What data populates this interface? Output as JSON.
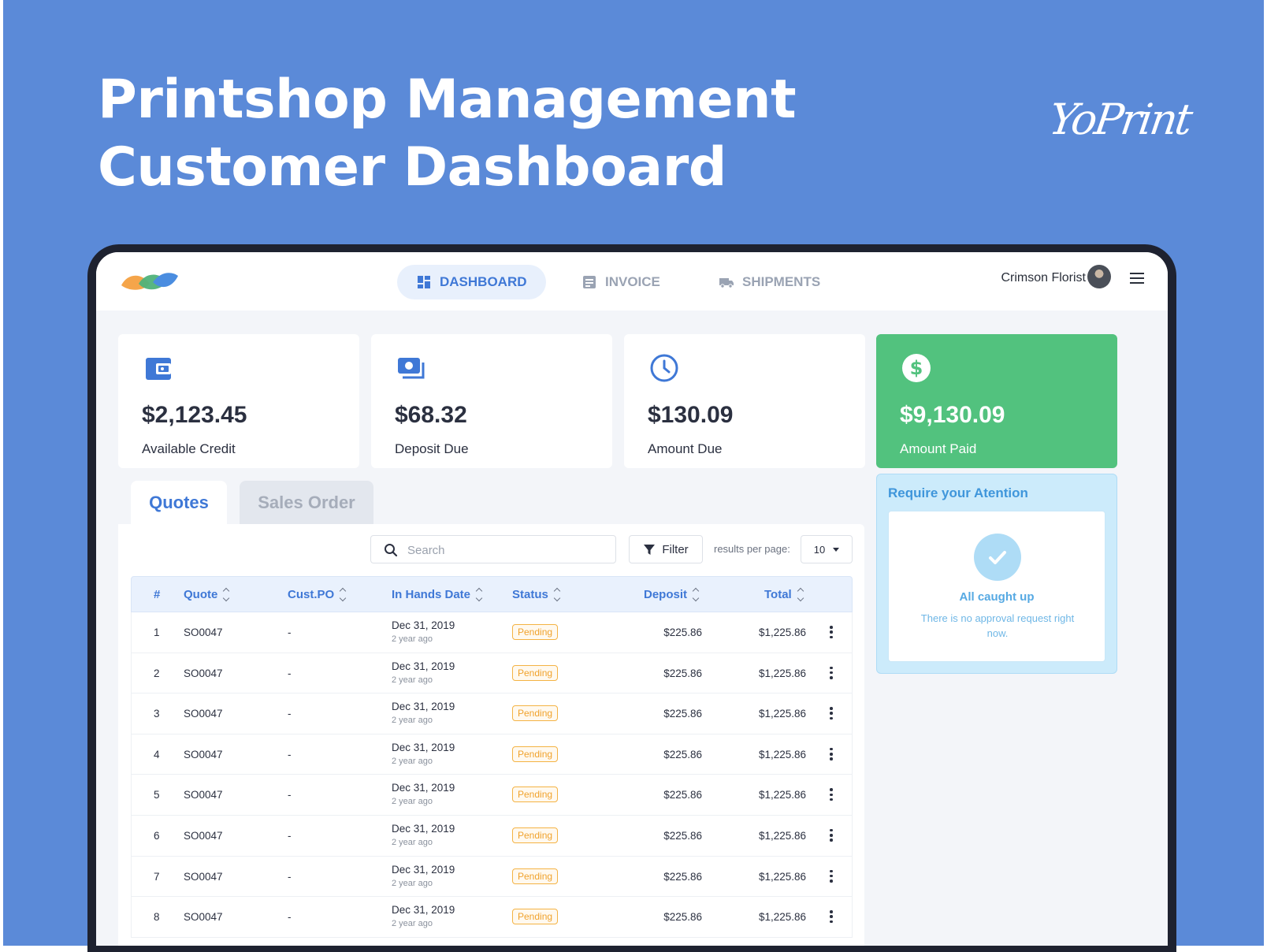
{
  "hero": {
    "title_line1": "Printshop Management",
    "title_line2": "Customer Dashboard",
    "brand": "YoPrint"
  },
  "nav": {
    "items": [
      {
        "label": "DASHBOARD",
        "icon": "dashboard-icon",
        "active": true
      },
      {
        "label": "INVOICE",
        "icon": "invoice-icon",
        "active": false
      },
      {
        "label": "SHIPMENTS",
        "icon": "truck-icon",
        "active": false
      }
    ],
    "user": "Crimson Florist"
  },
  "cards": [
    {
      "amount": "$2,123.45",
      "label": "Available Credit",
      "icon": "wallet-icon"
    },
    {
      "amount": "$68.32",
      "label": "Deposit Due",
      "icon": "cash-icon"
    },
    {
      "amount": "$130.09",
      "label": "Amount Due",
      "icon": "clock-icon"
    },
    {
      "amount": "$9,130.09",
      "label": "Amount Paid",
      "icon": "dollar-icon"
    }
  ],
  "tabs": [
    "Quotes",
    "Sales Order"
  ],
  "toolbar": {
    "search_placeholder": "Search",
    "filter_label": "Filter",
    "rpp_label": "results per page:",
    "rpp_value": "10"
  },
  "table": {
    "headers": [
      "#",
      "Quote",
      "Cust.PO",
      "In Hands Date",
      "Status",
      "Deposit",
      "Total"
    ],
    "rows": [
      {
        "num": "1",
        "quote": "SO0047",
        "po": "-",
        "date": "Dec 31, 2019",
        "ago": "2 year ago",
        "status": "Pending",
        "deposit": "$225.86",
        "total": "$1,225.86"
      },
      {
        "num": "2",
        "quote": "SO0047",
        "po": "-",
        "date": "Dec 31, 2019",
        "ago": "2 year ago",
        "status": "Pending",
        "deposit": "$225.86",
        "total": "$1,225.86"
      },
      {
        "num": "3",
        "quote": "SO0047",
        "po": "-",
        "date": "Dec 31, 2019",
        "ago": "2 year ago",
        "status": "Pending",
        "deposit": "$225.86",
        "total": "$1,225.86"
      },
      {
        "num": "4",
        "quote": "SO0047",
        "po": "-",
        "date": "Dec 31, 2019",
        "ago": "2 year ago",
        "status": "Pending",
        "deposit": "$225.86",
        "total": "$1,225.86"
      },
      {
        "num": "5",
        "quote": "SO0047",
        "po": "-",
        "date": "Dec 31, 2019",
        "ago": "2 year ago",
        "status": "Pending",
        "deposit": "$225.86",
        "total": "$1,225.86"
      },
      {
        "num": "6",
        "quote": "SO0047",
        "po": "-",
        "date": "Dec 31, 2019",
        "ago": "2 year ago",
        "status": "Pending",
        "deposit": "$225.86",
        "total": "$1,225.86"
      },
      {
        "num": "7",
        "quote": "SO0047",
        "po": "-",
        "date": "Dec 31, 2019",
        "ago": "2 year ago",
        "status": "Pending",
        "deposit": "$225.86",
        "total": "$1,225.86"
      },
      {
        "num": "8",
        "quote": "SO0047",
        "po": "-",
        "date": "Dec 31, 2019",
        "ago": "2 year ago",
        "status": "Pending",
        "deposit": "$225.86",
        "total": "$1,225.86"
      }
    ]
  },
  "attention": {
    "title": "Require your Atention",
    "heading": "All caught up",
    "message": "There is no approval request right now."
  },
  "colors": {
    "background": "#5b8ad8",
    "accent": "#3f78d6",
    "paid": "#52c27e",
    "pending": "#f0a22c",
    "attention": "#ccebfb"
  }
}
